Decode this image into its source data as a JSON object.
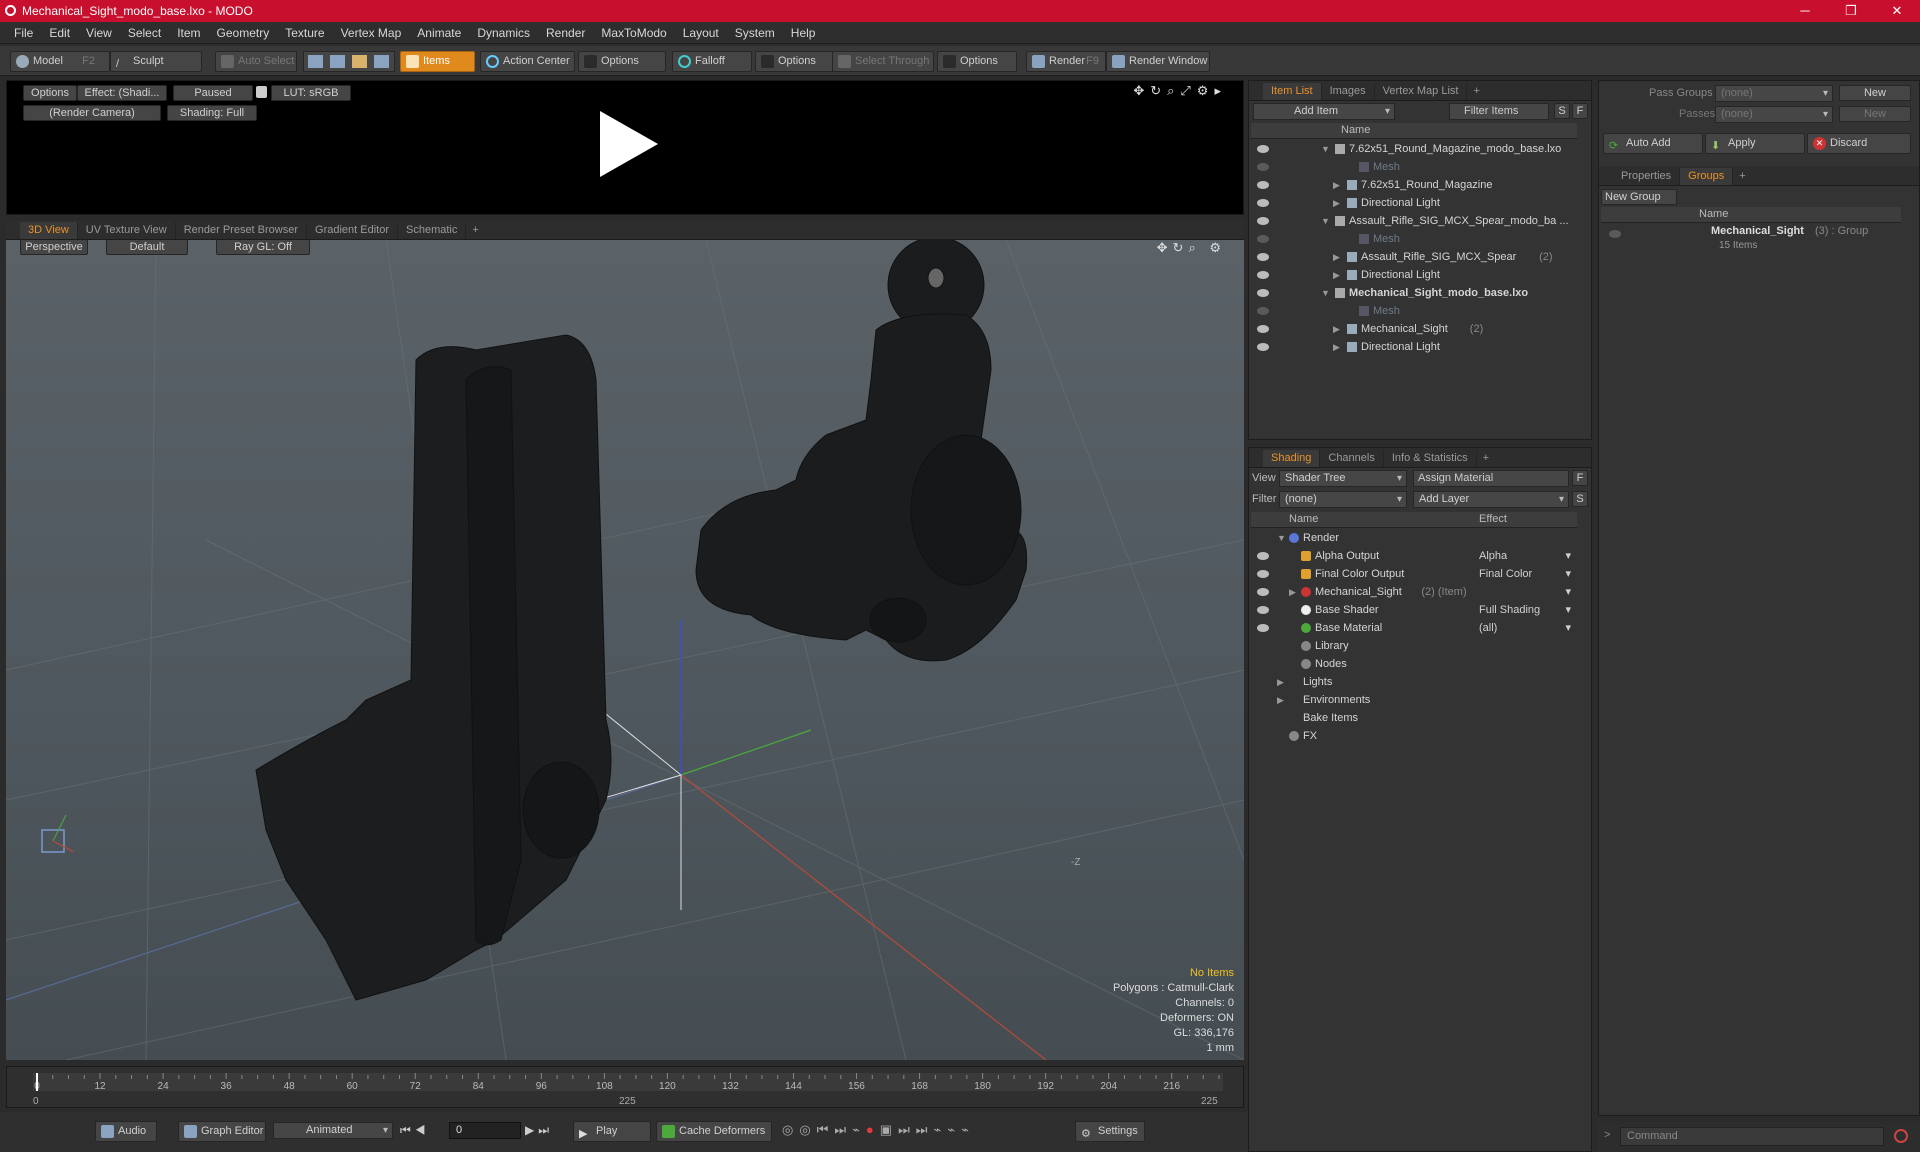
{
  "window": {
    "title": "Mechanical_Sight_modo_base.lxo - MODO",
    "min": "─",
    "max": "❐",
    "close": "✕"
  },
  "menu": [
    "File",
    "Edit",
    "View",
    "Select",
    "Item",
    "Geometry",
    "Texture",
    "Vertex Map",
    "Animate",
    "Dynamics",
    "Render",
    "MaxToModo",
    "Layout",
    "System",
    "Help"
  ],
  "toolbar": {
    "model": "Model",
    "model_key": "F2",
    "sculpt": "Sculpt",
    "auto_select": "Auto Select",
    "items": "Items",
    "action_center": "Action Center",
    "options1": "Options",
    "falloff": "Falloff",
    "options2": "Options",
    "select_through": "Select Through",
    "options3": "Options",
    "render": "Render",
    "render_key": "F9",
    "render_window": "Render Window"
  },
  "preview": {
    "options": "Options",
    "effect": "Effect: (Shadi...",
    "paused": "Paused",
    "lut": "LUT: sRGB",
    "camera": "(Render Camera)",
    "shading": "Shading: Full"
  },
  "viewport_tabs": [
    "3D View",
    "UV Texture View",
    "Render Preset Browser",
    "Gradient Editor",
    "Schematic"
  ],
  "viewport": {
    "perspective": "Perspective",
    "default": "Default",
    "raygl": "Ray GL: Off",
    "axis_label": "-Z",
    "stats": [
      "No Items",
      "Polygons : Catmull-Clark",
      "Channels: 0",
      "Deformers: ON",
      "GL: 336,176",
      "1 mm"
    ]
  },
  "timeline": {
    "ticks": [
      "0",
      "12",
      "24",
      "36",
      "48",
      "60",
      "72",
      "84",
      "96",
      "108",
      "120",
      "132",
      "144",
      "156",
      "168",
      "180",
      "192",
      "204",
      "216"
    ],
    "start": "0",
    "mid": "225",
    "end": "225"
  },
  "bottom": {
    "audio": "Audio",
    "graph_editor": "Graph Editor",
    "animated": "Animated",
    "frame": "0",
    "play": "Play",
    "cache": "Cache Deformers",
    "settings": "Settings"
  },
  "itemlist": {
    "tabs": [
      "Item List",
      "Images",
      "Vertex Map List"
    ],
    "add_item": "Add Item",
    "filter": "Filter Items",
    "s": "S",
    "f": "F",
    "col_name": "Name",
    "rows": [
      {
        "label": "7.62x51_Round_Magazine_modo_base.lxo",
        "indent": 0,
        "bold": false,
        "dim": false,
        "count": ""
      },
      {
        "label": "Mesh",
        "indent": 2,
        "bold": false,
        "dim": true,
        "count": ""
      },
      {
        "label": "7.62x51_Round_Magazine",
        "indent": 1,
        "bold": false,
        "dim": false,
        "count": ""
      },
      {
        "label": "Directional Light",
        "indent": 1,
        "bold": false,
        "dim": false,
        "count": ""
      },
      {
        "label": "Assault_Rifle_SIG_MCX_Spear_modo_ba ...",
        "indent": 0,
        "bold": false,
        "dim": false,
        "count": ""
      },
      {
        "label": "Mesh",
        "indent": 2,
        "bold": false,
        "dim": true,
        "count": ""
      },
      {
        "label": "Assault_Rifle_SIG_MCX_Spear",
        "indent": 1,
        "bold": false,
        "dim": false,
        "count": "(2)"
      },
      {
        "label": "Directional Light",
        "indent": 1,
        "bold": false,
        "dim": false,
        "count": ""
      },
      {
        "label": "Mechanical_Sight_modo_base.lxo",
        "indent": 0,
        "bold": true,
        "dim": false,
        "count": ""
      },
      {
        "label": "Mesh",
        "indent": 2,
        "bold": false,
        "dim": true,
        "count": ""
      },
      {
        "label": "Mechanical_Sight",
        "indent": 1,
        "bold": false,
        "dim": false,
        "count": "(2)"
      },
      {
        "label": "Directional Light",
        "indent": 1,
        "bold": false,
        "dim": false,
        "count": ""
      }
    ]
  },
  "groups": {
    "pass_groups": "Pass Groups",
    "passes": "Passes",
    "none1": "(none)",
    "none2": "(none)",
    "new1": "New",
    "new2": "New",
    "auto_add": "Auto Add",
    "apply": "Apply",
    "discard": "Discard",
    "tabs": [
      "Properties",
      "Groups"
    ],
    "new_group": "New Group",
    "col_name": "Name",
    "item": "Mechanical_Sight",
    "item_suffix": "(3) : Group",
    "item_sub": "15 Items"
  },
  "shading": {
    "tabs": [
      "Shading",
      "Channels",
      "Info & Statistics"
    ],
    "view_label": "View",
    "view_value": "Shader Tree",
    "assign": "Assign Material",
    "filter_label": "Filter",
    "filter_value": "(none)",
    "add_layer": "Add Layer",
    "f": "F",
    "s": "S",
    "col_name": "Name",
    "col_effect": "Effect",
    "rows": [
      {
        "label": "Render",
        "effect": "",
        "indent": 0,
        "suffix": ""
      },
      {
        "label": "Alpha Output",
        "effect": "Alpha",
        "indent": 1,
        "suffix": ""
      },
      {
        "label": "Final Color Output",
        "effect": "Final Color",
        "indent": 1,
        "suffix": ""
      },
      {
        "label": "Mechanical_Sight",
        "effect": "",
        "indent": 1,
        "suffix": "(2) (Item)"
      },
      {
        "label": "Base Shader",
        "effect": "Full Shading",
        "indent": 1,
        "suffix": ""
      },
      {
        "label": "Base Material",
        "effect": "(all)",
        "indent": 1,
        "suffix": ""
      },
      {
        "label": "Library",
        "effect": "",
        "indent": 1,
        "suffix": ""
      },
      {
        "label": "Nodes",
        "effect": "",
        "indent": 1,
        "suffix": ""
      },
      {
        "label": "Lights",
        "effect": "",
        "indent": 0,
        "suffix": ""
      },
      {
        "label": "Environments",
        "effect": "",
        "indent": 0,
        "suffix": ""
      },
      {
        "label": "Bake Items",
        "effect": "",
        "indent": 0,
        "suffix": ""
      },
      {
        "label": "FX",
        "effect": "",
        "indent": 0,
        "suffix": ""
      }
    ]
  },
  "command": {
    "placeholder": "Command"
  },
  "colors": {
    "accent": "#e08a1e",
    "titlebar": "#c8102e"
  }
}
